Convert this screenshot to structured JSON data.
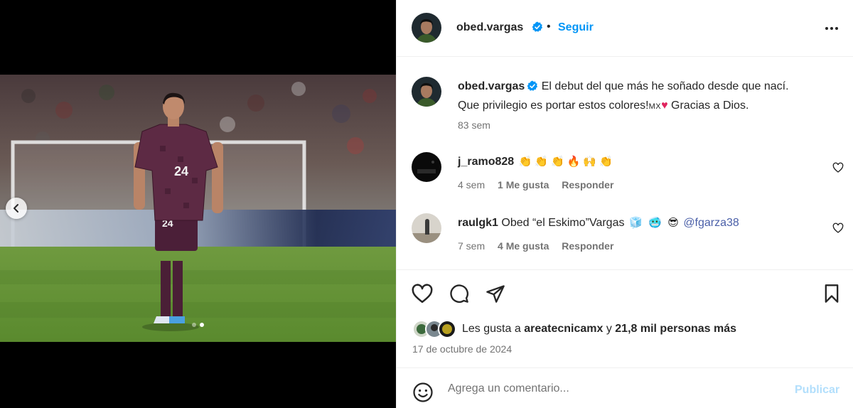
{
  "post": {
    "username": "obed.vargas",
    "separator": "•",
    "follow_label": "Seguir",
    "verified": true
  },
  "caption": {
    "username": "obed.vargas",
    "text_line1": "El debut del que más he soñado desde que nací.",
    "text_line2_a": "Que privilegio es portar estos colores!",
    "flag_label": "MX",
    "text_line2_b": "Gracias a Dios.",
    "time": "83 sem"
  },
  "comments": [
    {
      "username": "j_ramo828",
      "text": "",
      "emojis": [
        "👏",
        "👏",
        "👏",
        "🔥",
        "🙌",
        "👏"
      ],
      "time": "4 sem",
      "likes": "1 Me gusta",
      "reply_label": "Responder"
    },
    {
      "username": "raulgk1",
      "text": "Obed “el Eskimo”Vargas",
      "emojis": [
        "🧊",
        "🥶",
        "😎"
      ],
      "mention": "@fgarza38",
      "time": "7 sem",
      "likes": "4 Me gusta",
      "reply_label": "Responder"
    }
  ],
  "likes_summary": {
    "prefix": "Les gusta a",
    "first_user": "areatecnicamx",
    "connector": "y",
    "others": "21,8 mil personas más"
  },
  "post_date": "17 de octubre de 2024",
  "composer": {
    "placeholder": "Agrega un comentario...",
    "publish_label": "Publicar"
  },
  "carousel": {
    "slide_count": 2,
    "active_index": 1
  },
  "icons": {
    "verified": "verified-badge-icon",
    "more": "more-options-icon",
    "like": "heart-icon",
    "comment": "comment-icon",
    "share": "share-icon",
    "save": "bookmark-icon",
    "emoji": "emoji-icon",
    "prev": "chevron-left-icon"
  },
  "colors": {
    "accent": "#0095f6",
    "verified": "#0095f6",
    "muted": "#737373",
    "publish_disabled": "#b2dffc",
    "heart": "#e0245e"
  }
}
